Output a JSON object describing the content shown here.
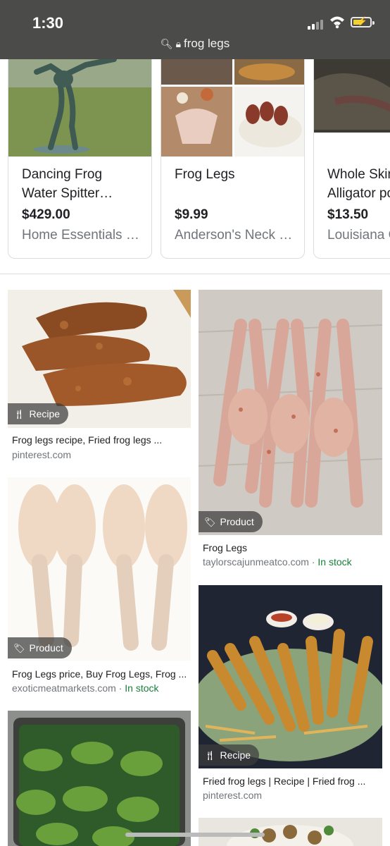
{
  "status_bar": {
    "time": "1:30",
    "url": "frog legs"
  },
  "shopping_cards": [
    {
      "title_line1": "Dancing Frog",
      "title_line2": "Water Spitter…",
      "price": "$429.00",
      "store": "Home Essentials …"
    },
    {
      "title_line1": "Frog Legs",
      "title_line2": "",
      "price": "$9.99",
      "store": "Anderson's Neck …"
    },
    {
      "title_line1": "Whole Skin",
      "title_line2": "Alligator po",
      "price": "$13.50",
      "store": "Louisiana C"
    }
  ],
  "results": [
    {
      "badge": "Recipe",
      "caption": "Frog legs recipe, Fried frog legs ...",
      "source": "pinterest.com",
      "stock": ""
    },
    {
      "badge": "Product",
      "caption": "Frog Legs",
      "source": "taylorscajunmeatco.com · ",
      "stock": "In stock"
    },
    {
      "badge": "Product",
      "caption": "Frog Legs price, Buy Frog Legs, Frog ...",
      "source": "exoticmeatmarkets.com · ",
      "stock": "In stock"
    },
    {
      "badge": "Recipe",
      "caption": "Fried frog legs | Recipe | Fried frog ...",
      "source": "pinterest.com",
      "stock": ""
    }
  ],
  "icons": {
    "search": "search-icon",
    "lock": "lock-icon",
    "recipe": "fork-knife-icon",
    "product": "tag-icon"
  }
}
